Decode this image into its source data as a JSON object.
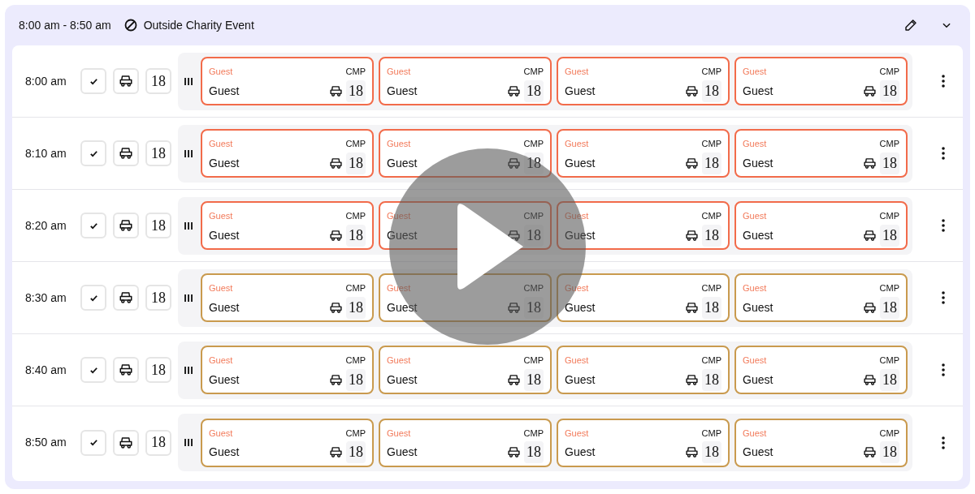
{
  "header": {
    "time_range": "8:00 am - 8:50 am",
    "event": "Outside Charity Event"
  },
  "rows": [
    {
      "time": "8:00 am",
      "holes": "18",
      "color": "#f26b4a",
      "slots": [
        {
          "tag": "Guest",
          "rate": "CMP",
          "name": "Guest",
          "holes": "18"
        },
        {
          "tag": "Guest",
          "rate": "CMP",
          "name": "Guest",
          "holes": "18"
        },
        {
          "tag": "Guest",
          "rate": "CMP",
          "name": "Guest",
          "holes": "18"
        },
        {
          "tag": "Guest",
          "rate": "CMP",
          "name": "Guest",
          "holes": "18"
        }
      ]
    },
    {
      "time": "8:10 am",
      "holes": "18",
      "color": "#f26b4a",
      "slots": [
        {
          "tag": "Guest",
          "rate": "CMP",
          "name": "Guest",
          "holes": "18"
        },
        {
          "tag": "Guest",
          "rate": "CMP",
          "name": "Guest",
          "holes": "18"
        },
        {
          "tag": "Guest",
          "rate": "CMP",
          "name": "Guest",
          "holes": "18"
        },
        {
          "tag": "Guest",
          "rate": "CMP",
          "name": "Guest",
          "holes": "18"
        }
      ]
    },
    {
      "time": "8:20 am",
      "holes": "18",
      "color": "#f26b4a",
      "slots": [
        {
          "tag": "Guest",
          "rate": "CMP",
          "name": "Guest",
          "holes": "18"
        },
        {
          "tag": "Guest",
          "rate": "CMP",
          "name": "Guest",
          "holes": "18"
        },
        {
          "tag": "Guest",
          "rate": "CMP",
          "name": "Guest",
          "holes": "18"
        },
        {
          "tag": "Guest",
          "rate": "CMP",
          "name": "Guest",
          "holes": "18"
        }
      ]
    },
    {
      "time": "8:30 am",
      "holes": "18",
      "color": "#c99a4e",
      "slots": [
        {
          "tag": "Guest",
          "rate": "CMP",
          "name": "Guest",
          "holes": "18"
        },
        {
          "tag": "Guest",
          "rate": "CMP",
          "name": "Guest",
          "holes": "18"
        },
        {
          "tag": "Guest",
          "rate": "CMP",
          "name": "Guest",
          "holes": "18"
        },
        {
          "tag": "Guest",
          "rate": "CMP",
          "name": "Guest",
          "holes": "18"
        }
      ]
    },
    {
      "time": "8:40 am",
      "holes": "18",
      "color": "#c99a4e",
      "slots": [
        {
          "tag": "Guest",
          "rate": "CMP",
          "name": "Guest",
          "holes": "18"
        },
        {
          "tag": "Guest",
          "rate": "CMP",
          "name": "Guest",
          "holes": "18"
        },
        {
          "tag": "Guest",
          "rate": "CMP",
          "name": "Guest",
          "holes": "18"
        },
        {
          "tag": "Guest",
          "rate": "CMP",
          "name": "Guest",
          "holes": "18"
        }
      ]
    },
    {
      "time": "8:50 am",
      "holes": "18",
      "color": "#c99a4e",
      "slots": [
        {
          "tag": "Guest",
          "rate": "CMP",
          "name": "Guest",
          "holes": "18"
        },
        {
          "tag": "Guest",
          "rate": "CMP",
          "name": "Guest",
          "holes": "18"
        },
        {
          "tag": "Guest",
          "rate": "CMP",
          "name": "Guest",
          "holes": "18"
        },
        {
          "tag": "Guest",
          "rate": "CMP",
          "name": "Guest",
          "holes": "18"
        }
      ]
    }
  ]
}
